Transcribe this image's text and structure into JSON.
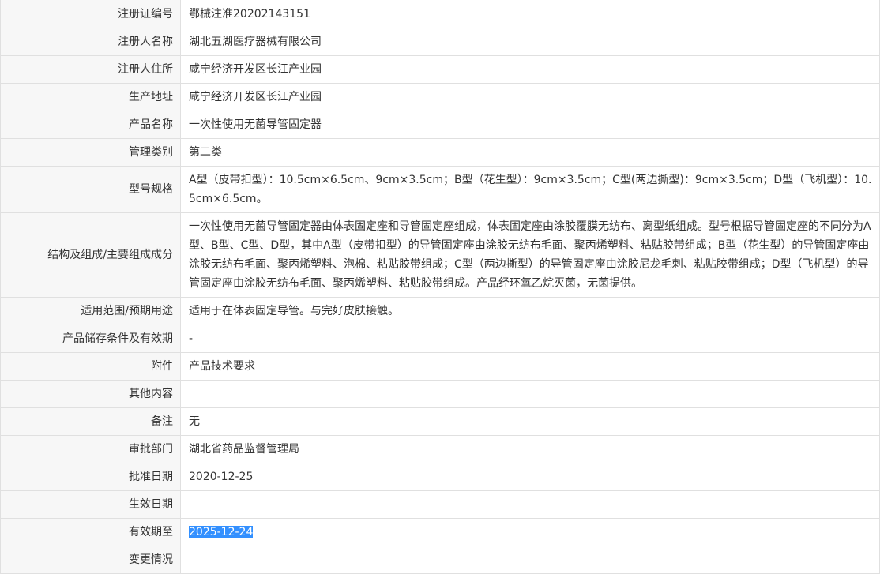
{
  "rows": [
    {
      "label": "注册证编号",
      "value": "鄂械注准20202143151"
    },
    {
      "label": "注册人名称",
      "value": "湖北五湖医疗器械有限公司"
    },
    {
      "label": "注册人住所",
      "value": "咸宁经济开发区长江产业园"
    },
    {
      "label": "生产地址",
      "value": "咸宁经济开发区长江产业园"
    },
    {
      "label": "产品名称",
      "value": "一次性使用无菌导管固定器"
    },
    {
      "label": "管理类别",
      "value": "第二类"
    },
    {
      "label": "型号规格",
      "value": "A型（皮带扣型）：10.5cm×6.5cm、9cm×3.5cm；B型（花生型）：9cm×3.5cm；C型(两边撕型)：9cm×3.5cm；D型（飞机型）：10.5cm×6.5cm。"
    },
    {
      "label": "结构及组成/主要组成成分",
      "value": "一次性使用无菌导管固定器由体表固定座和导管固定座组成，体表固定座由涂胶覆膜无纺布、离型纸组成。型号根据导管固定座的不同分为A型、B型、C型、D型，其中A型（皮带扣型）的导管固定座由涂胶无纺布毛面、聚丙烯塑料、粘贴胶带组成；B型（花生型）的导管固定座由涂胶无纺布毛面、聚丙烯塑料、泡棉、粘贴胶带组成；C型（两边撕型）的导管固定座由涂胶尼龙毛刺、粘贴胶带组成；D型（飞机型）的导管固定座由涂胶无纺布毛面、聚丙烯塑料、粘贴胶带组成。产品经环氧乙烷灭菌，无菌提供。"
    },
    {
      "label": "适用范围/预期用途",
      "value": "适用于在体表固定导管。与完好皮肤接触。"
    },
    {
      "label": "产品储存条件及有效期",
      "value": "-"
    },
    {
      "label": "附件",
      "value": "产品技术要求"
    },
    {
      "label": "其他内容",
      "value": ""
    },
    {
      "label": "备注",
      "value": "无"
    },
    {
      "label": "审批部门",
      "value": "湖北省药品监督管理局"
    },
    {
      "label": "批准日期",
      "value": "2020-12-25"
    },
    {
      "label": "生效日期",
      "value": ""
    },
    {
      "label": "有效期至",
      "value": "2025-12-24"
    },
    {
      "label": "变更情况",
      "value": ""
    }
  ]
}
